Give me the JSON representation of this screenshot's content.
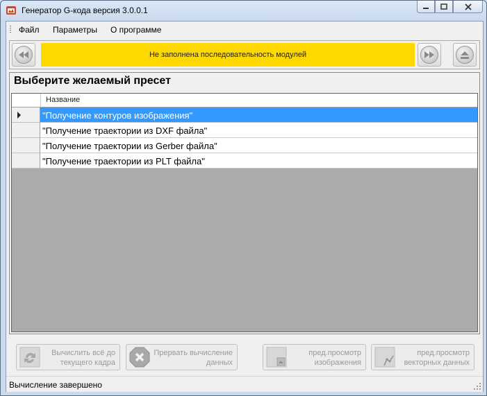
{
  "window": {
    "title": "Генератор G-кода версия 3.0.0.1"
  },
  "menu": {
    "items": [
      "Файл",
      "Параметры",
      "О программе"
    ]
  },
  "modules": {
    "status_message": "Не заполнена последовательность модулей"
  },
  "presets": {
    "heading": "Выберите желаемый пресет",
    "column_header": "Название",
    "rows": [
      "\"Получение контуров изображения\"",
      "\"Получение траектории из DXF файла\"",
      "\"Получение траектории из Gerber файла\"",
      "\"Получение траектории из PLT файла\""
    ],
    "selected_index": 0
  },
  "actions": {
    "compute_to_frame": {
      "line1": "Вычислить всё до",
      "line2": "текущего кадра"
    },
    "abort": {
      "line1": "Прервать вычисление",
      "line2": "данных"
    },
    "preview_image": {
      "line1": "пред.просмотр",
      "line2": "изображения"
    },
    "preview_vector": {
      "line1": "пред.просмотр",
      "line2": "векторных данных"
    }
  },
  "status": {
    "text": "Вычисление завершено"
  },
  "colors": {
    "highlight": "#3399ff",
    "module_bar": "#ffd800",
    "grid_bg": "#ababab"
  }
}
